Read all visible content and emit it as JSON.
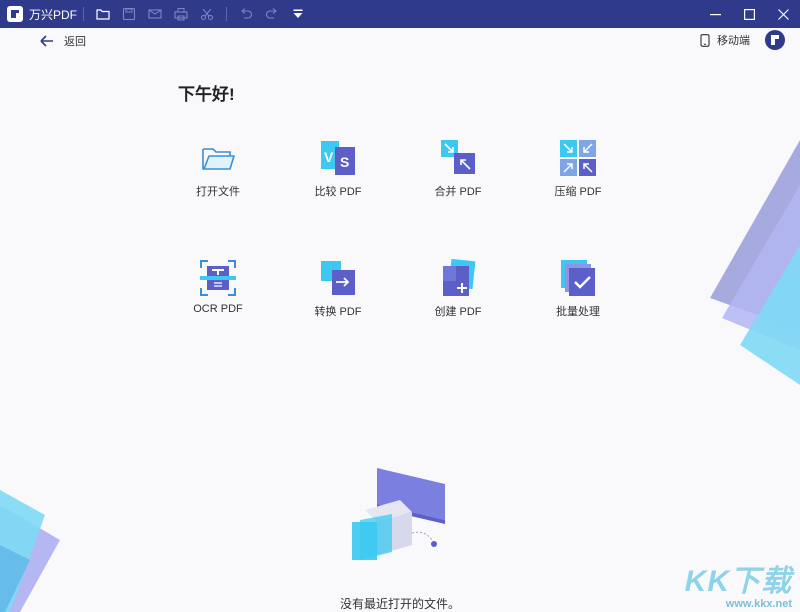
{
  "app": {
    "name": "万兴PDF"
  },
  "toolbar": {
    "icons": [
      "open-folder-icon",
      "save-icon",
      "mail-icon",
      "print-icon",
      "cut-icon",
      "undo-icon",
      "redo-icon",
      "dropdown-menu-icon"
    ]
  },
  "header": {
    "back_label": "返回",
    "mobile_label": "移动端"
  },
  "main": {
    "greeting": "下午好!",
    "tools": [
      {
        "label": "打开文件",
        "icon": "open-file-icon"
      },
      {
        "label": "比较 PDF",
        "icon": "compare-pdf-icon"
      },
      {
        "label": "合并 PDF",
        "icon": "merge-pdf-icon"
      },
      {
        "label": "压缩 PDF",
        "icon": "compress-pdf-icon"
      },
      {
        "label": "OCR PDF",
        "icon": "ocr-pdf-icon"
      },
      {
        "label": "转换 PDF",
        "icon": "convert-pdf-icon"
      },
      {
        "label": "创建 PDF",
        "icon": "create-pdf-icon"
      },
      {
        "label": "批量处理",
        "icon": "batch-process-icon"
      }
    ],
    "empty_message": "没有最近打开的文件。"
  },
  "watermark": {
    "main": "KK下载",
    "url": "www.kkx.net"
  },
  "colors": {
    "titlebar": "#2f3a8a",
    "accent": "#5b5fc7",
    "cyan": "#3cc8f0"
  }
}
